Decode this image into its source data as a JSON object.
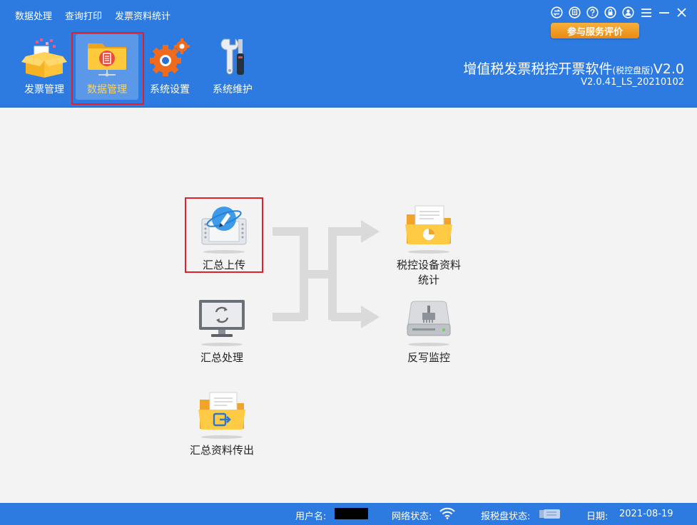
{
  "menu": [
    "数据处理",
    "查询打印",
    "发票资料统计"
  ],
  "window_controls": [
    "swap-icon",
    "feedback-icon",
    "help-icon",
    "lock-icon",
    "user-icon",
    "menu-icon",
    "minimize-icon",
    "close-icon"
  ],
  "rate_button": "参与服务评价",
  "toolbar": [
    {
      "label": "发票管理",
      "icon": "invoice-box-icon"
    },
    {
      "label": "数据管理",
      "icon": "data-folder-icon",
      "active": true
    },
    {
      "label": "系统设置",
      "icon": "gears-icon"
    },
    {
      "label": "系统维护",
      "icon": "tools-icon"
    }
  ],
  "app": {
    "title_main": "增值税发票税控开票软件",
    "title_edition": "(税控盘版)",
    "title_suffix": "V2.0",
    "version": "V2.0.41_LS_20210102"
  },
  "features": {
    "summary_upload": "汇总上传",
    "summary_process": "汇总处理",
    "summary_export": "汇总资料传出",
    "device_stats_line1": "税控设备资料",
    "device_stats_line2": "统计",
    "writeback_monitor": "反写监控"
  },
  "status": {
    "username_label": "用户名:",
    "network_label": "网络状态:",
    "disk_label": "报税盘状态:",
    "date_label": "日期:",
    "date_value": "2021-08-19"
  },
  "colors": {
    "header_blue": "#2d7be0",
    "highlight_red": "#e0202a",
    "rate_orange": "#e98a13",
    "active_label": "#ffd35a"
  }
}
